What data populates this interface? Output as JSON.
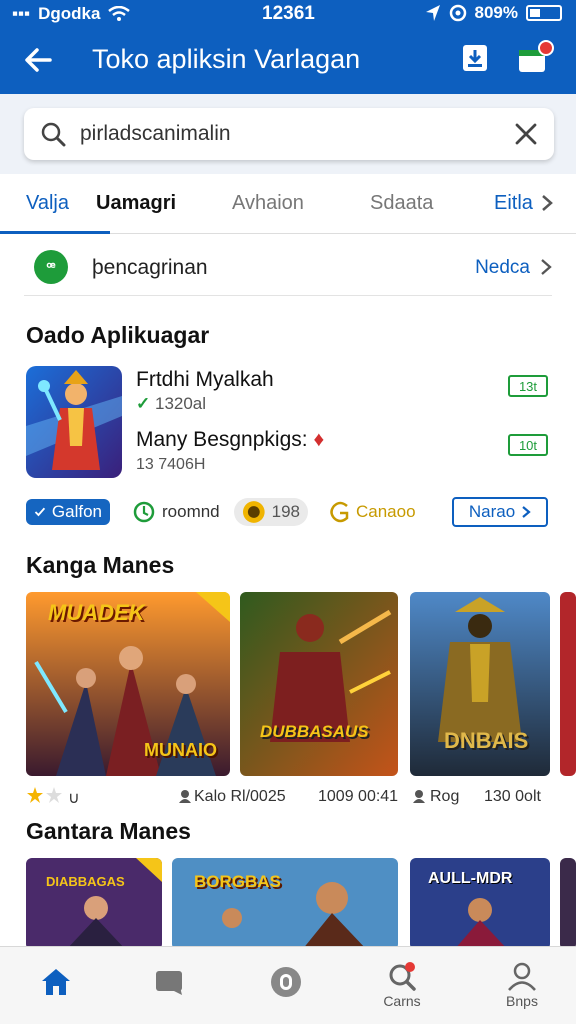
{
  "status_bar": {
    "carrier": "Dgodka",
    "time": "12361",
    "battery": "809%"
  },
  "app_bar": {
    "title": "Toko apliksin Varlagan"
  },
  "search": {
    "value": "pirladscanimalin"
  },
  "tabs": [
    {
      "label": "Valja"
    },
    {
      "label": "Uamagri"
    },
    {
      "label": "Avhaion"
    },
    {
      "label": "Sdaata"
    },
    {
      "label": "Eitla"
    }
  ],
  "suggestion": {
    "icon_text": "ꟹ",
    "text": "þencagrinan",
    "link": "Nedca"
  },
  "section_featured": {
    "title": "Oado Aplikuagar",
    "app1_name": "Frtdhi Myalkah",
    "app1_meta_icon": "✓",
    "app1_meta": "1320al",
    "app1_btn": "13t",
    "app2_name": "Many Besgnpkigs:",
    "app2_badge": "♦",
    "app2_meta": "13 7406H",
    "app2_btn": "10t"
  },
  "chips": {
    "chip1": "Galfon",
    "chip2": "roomnd",
    "chip3": "198",
    "chip4": "Canaoo",
    "more": "Narao"
  },
  "section_games": {
    "title": "Kanga Manes",
    "cards": [
      {
        "title": "MUADEK",
        "subtitle": "MUNAIO"
      },
      {
        "title": "DUBBASAUS"
      },
      {
        "title": "DNBAIS"
      }
    ],
    "captions": [
      "Kalo Rl/0025",
      "1009 00:41",
      "Rog",
      "130 0olt"
    ]
  },
  "section_second": {
    "title": "Gantara Manes",
    "cards": [
      {
        "title": "DIABBAGAS"
      },
      {
        "title": "BORGBAS"
      },
      {
        "title": "AULL-MDR"
      }
    ]
  },
  "bottom_nav": [
    {
      "label": ""
    },
    {
      "label": ""
    },
    {
      "label": ""
    },
    {
      "label": "Carns"
    },
    {
      "label": "Bnps"
    }
  ],
  "colors": {
    "primary": "#0d5fbf",
    "green": "#1e9c3a",
    "red": "#e53935"
  }
}
